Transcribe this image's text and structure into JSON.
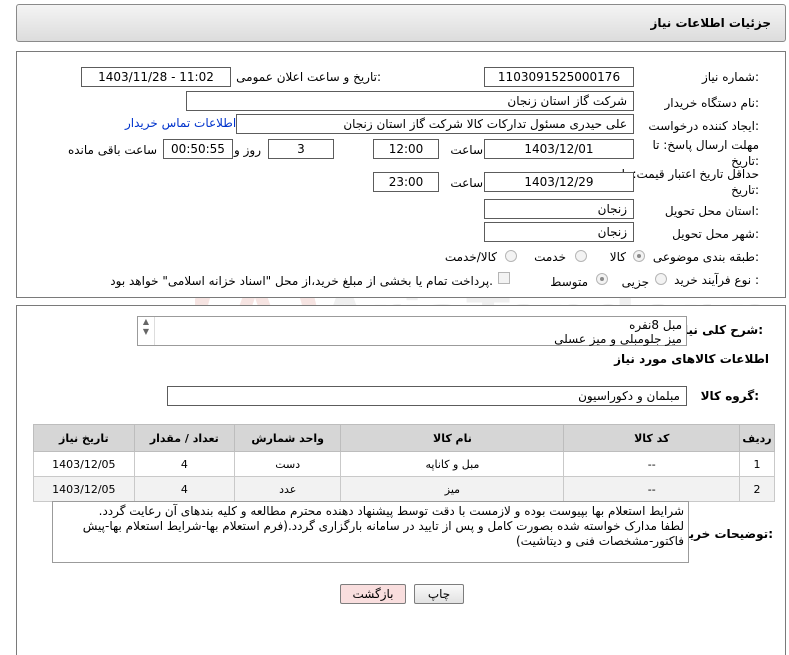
{
  "header": {
    "title": "جزئیات اطلاعات نیاز"
  },
  "form": {
    "need_number_label": "شماره نیاز:",
    "need_number": "1103091525000176",
    "announce_label": "تاریخ و ساعت اعلان عمومی:",
    "announce_value": "1403/11/28 - 11:02",
    "buyer_label": "نام دستگاه خریدار:",
    "buyer_value": "شرکت گاز استان زنجان",
    "creator_label": "ایجاد کننده درخواست:",
    "creator_value": "علی حیدری مسئول تدارکات کالا شرکت گاز استان زنجان",
    "contact_link": "اطلاعات تماس خریدار",
    "reply_deadline_label": "مهلت ارسال پاسخ: تا تاریخ:",
    "reply_date": "1403/12/01",
    "time_label": "ساعت",
    "reply_time": "12:00",
    "days_value": "3",
    "days_label": "روز و",
    "remaining_value": "00:50:55",
    "remaining_label": "ساعت باقی مانده",
    "price_validity_label": "حداقل تاریخ اعتبار قیمت: تا تاریخ:",
    "price_date": "1403/12/29",
    "time_label2": "ساعت",
    "price_time": "23:00",
    "province_label": "استان محل تحویل:",
    "province_value": "زنجان",
    "city_label": "شهر محل تحویل:",
    "city_value": "زنجان",
    "category_label": "طبقه بندی موضوعی:",
    "category_options": [
      "کالا",
      "خدمت",
      "کالا/خدمت"
    ],
    "process_label": "نوع فرآیند خرید :",
    "process_options": [
      "جزیی",
      "متوسط"
    ],
    "payment_note": "پرداخت تمام یا بخشی از مبلغ خرید،از محل \"اسناد خزانه اسلامی\" خواهد بود."
  },
  "summary": {
    "label": "شرح کلی نیاز:",
    "line1": "مبل 8نفره",
    "line2": "میز جلومبلی و میز عسلی"
  },
  "goods": {
    "section_title": "اطلاعات کالاهای مورد نیاز",
    "group_label": "گروه کالا:",
    "group_value": "مبلمان و دکوراسیون"
  },
  "table": {
    "headers": {
      "row": "ردیف",
      "code": "کد کالا",
      "name": "نام کالا",
      "unit": "واحد شمارش",
      "qty": "تعداد / مقدار",
      "date": "تاریخ نیاز"
    },
    "rows": [
      {
        "row": "1",
        "code": "--",
        "name": "مبل و کاناپه",
        "unit": "دست",
        "qty": "4",
        "date": "1403/12/05"
      },
      {
        "row": "2",
        "code": "--",
        "name": "میز",
        "unit": "عدد",
        "qty": "4",
        "date": "1403/12/05"
      }
    ]
  },
  "notes": {
    "label": "توضیحات خریدار:",
    "line1": "شرایط استعلام بها بپیوست بوده و لازمست با دقت توسط پیشنهاد دهنده محترم مطالعه و کلیه بندهای آن رعایت گردد.",
    "line2": "لطفا مدارک خواسته شده بصورت کامل و پس از تایید در سامانه بارگزاری گردد.(فرم استعلام بها-شرایط استعلام بها-پیش",
    "line3": "فاکتور-مشخصات فنی و دیتاشیت)"
  },
  "buttons": {
    "print": "چاپ",
    "back": "بازگشت"
  },
  "watermark": {
    "text": "AriaTender.neT"
  },
  "colors": {
    "link": "#0033cc",
    "back_button_bg": "#f9dede"
  }
}
